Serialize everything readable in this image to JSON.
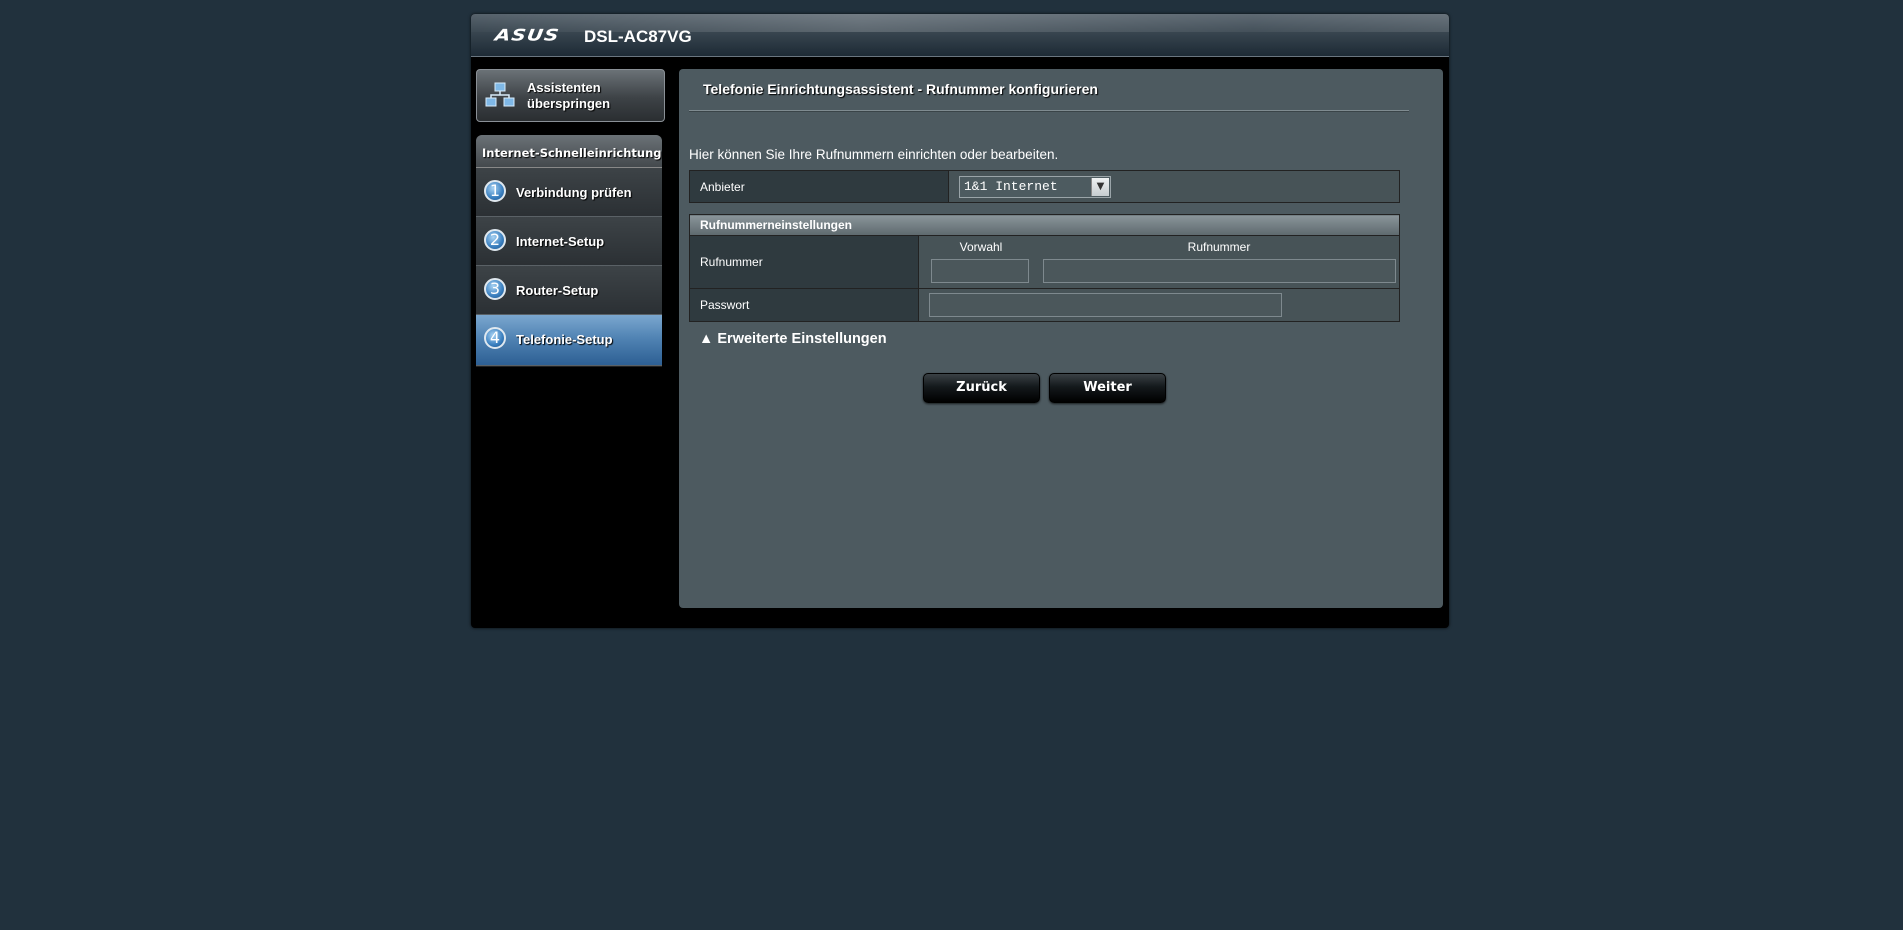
{
  "header": {
    "logo": "ASUS",
    "model": "DSL-AC87VG"
  },
  "sidebar": {
    "skip_button": "Assistenten überspringen",
    "panel_title": "Internet-Schnelleinrichtung",
    "steps": [
      {
        "number": "1",
        "label": "Verbindung prüfen",
        "active": false
      },
      {
        "number": "2",
        "label": "Internet-Setup",
        "active": false
      },
      {
        "number": "3",
        "label": "Router-Setup",
        "active": false
      },
      {
        "number": "4",
        "label": "Telefonie-Setup",
        "active": true
      }
    ]
  },
  "main": {
    "title": "Telefonie Einrichtungsassistent - Rufnummer konfigurieren",
    "intro": "Hier können Sie Ihre Rufnummern einrichten oder bearbeiten.",
    "provider": {
      "label": "Anbieter",
      "selected": "1&1 Internet"
    },
    "numbers_section": {
      "title": "Rufnummerneinstellungen",
      "number_label": "Rufnummer",
      "area_code_header": "Vorwahl",
      "number_header": "Rufnummer",
      "area_code_value": "",
      "number_value": "",
      "password_label": "Passwort",
      "password_value": ""
    },
    "advanced": "▲ Erweiterte Einstellungen",
    "back_button": "Zurück",
    "next_button": "Weiter"
  }
}
